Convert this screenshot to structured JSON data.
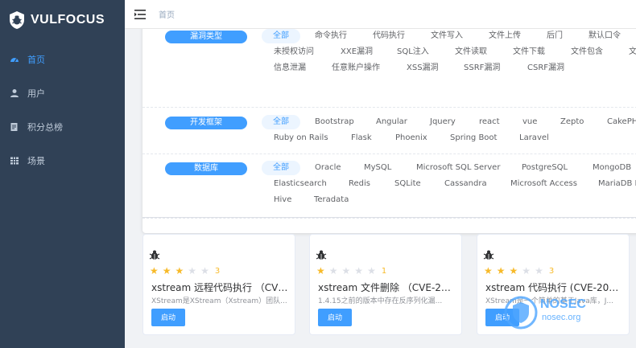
{
  "app": {
    "logo_text": "VULFOCUS"
  },
  "sidebar": {
    "items": [
      {
        "label": "首页",
        "icon": "dashboard-icon"
      },
      {
        "label": "用户",
        "icon": "user-icon"
      },
      {
        "label": "积分总榜",
        "icon": "document-icon"
      },
      {
        "label": "场景",
        "icon": "table-icon"
      }
    ]
  },
  "header": {
    "breadcrumb": "首页"
  },
  "filters": {
    "vuln_type": {
      "label": "漏洞类型",
      "tags": [
        "全部",
        "命令执行",
        "代码执行",
        "文件写入",
        "文件上传",
        "后门",
        "默认口令",
        "未授权访问",
        "XXE漏洞",
        "SQL注入",
        "文件读取",
        "文件下载",
        "文件包含",
        "文",
        "信息泄漏",
        "任意账户操作",
        "XSS漏洞",
        "SSRF漏洞",
        "CSRF漏洞"
      ]
    },
    "framework": {
      "label": "开发框架",
      "tags": [
        "全部",
        "Bootstrap",
        "Angular",
        "Jquery",
        "react",
        "vue",
        "Zepto",
        "CakePH",
        "Ruby on Rails",
        "Flask",
        "Phoenix",
        "Spring Boot",
        "Laravel"
      ]
    },
    "database": {
      "label": "数据库",
      "tags": [
        "全部",
        "Oracle",
        "MySQL",
        "Microsoft SQL Server",
        "PostgreSQL",
        "MongoDB",
        "Elasticsearch",
        "Redis",
        "SQLite",
        "Cassandra",
        "Microsoft Access",
        "MariaDB I",
        "Hive",
        "Teradata"
      ]
    }
  },
  "cards": [
    {
      "rating": 3,
      "rating_text": "3",
      "title": "xstream 远程代码执行 （CVE-2021-...",
      "desc": "XStream是XStream（Xstream）团队...",
      "button": "启动"
    },
    {
      "rating": 1,
      "rating_text": "1",
      "title": "xstream 文件删除 （CVE-2021-...",
      "desc": "1.4.15之前的版本中存在反序列化漏...",
      "button": "启动"
    },
    {
      "rating": 3,
      "rating_text": "3",
      "title": "xstream 代码执行 (CVE-2021-...",
      "desc": "XStream是一个简单的基于Java库，J...",
      "button": "启动"
    }
  ],
  "watermark": {
    "title": "NOSEC",
    "subtitle": "nosec.org"
  },
  "colors": {
    "sidebar_bg": "#304156",
    "accent": "#409eff",
    "star": "#f7ba2a"
  }
}
